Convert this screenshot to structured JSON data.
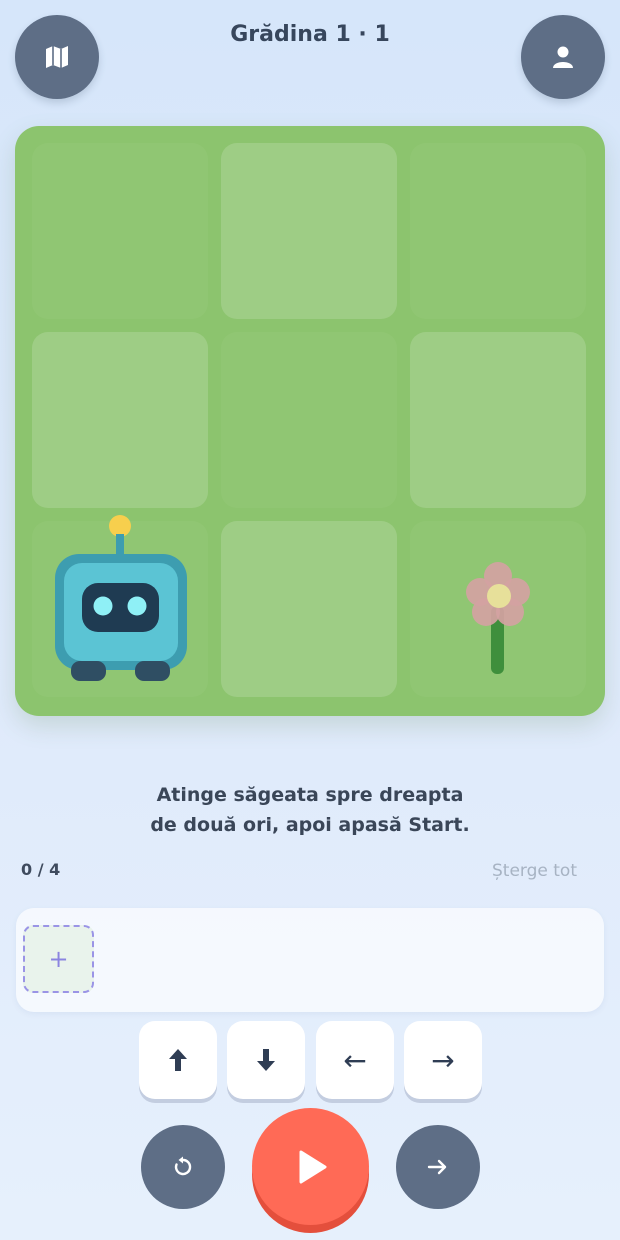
{
  "header": {
    "title": "Grădina 1 · 1",
    "map_icon": "map-icon",
    "profile_icon": "user-icon"
  },
  "board": {
    "rows": 3,
    "cols": 3,
    "robot_cell": [
      2,
      0
    ],
    "flower_cell": [
      2,
      2
    ],
    "colors": {
      "grass": "#8cc46e",
      "robot": "#5bc4d4",
      "flower": "#d4a2a2"
    }
  },
  "instruction": {
    "line1": "Atinge săgeata spre dreapta",
    "line2": "de două ori, apoi apasă Start."
  },
  "program": {
    "counter": "0 / 4",
    "clear_label": "Șterge tot",
    "add_slot": "+"
  },
  "commands": {
    "up": "🡅",
    "down": "🡇",
    "left": "←",
    "right": "→"
  },
  "controls": {
    "reset_icon": "reset-icon",
    "play_icon": "play-icon",
    "step_icon": "step-arrow-icon",
    "accent": "#ff6a56"
  }
}
